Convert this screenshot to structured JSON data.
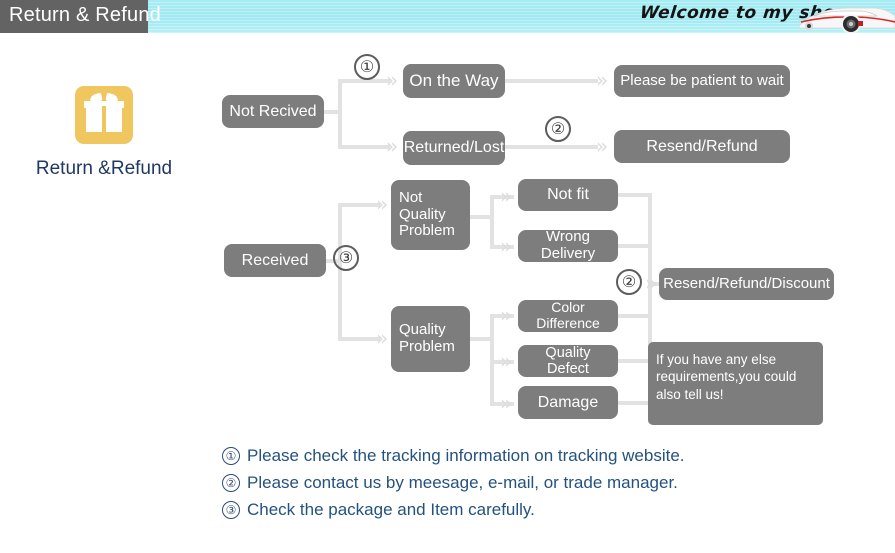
{
  "header": {
    "tab_title": "Return & Refund",
    "welcome_text": "Welcome to my shop",
    "car_icon": "sports-car-image",
    "banner_color": "#9fe9f2",
    "tab_color": "#636363"
  },
  "badge": {
    "icon": "gift-box-icon",
    "icon_color": "#f0c75e",
    "label": "Return &Refund",
    "label_color": "#1f3864"
  },
  "flow": {
    "node_color": "#7d7d7d",
    "line_color": "#e2e2e2",
    "nodes": [
      {
        "id": "not-recived",
        "label": "Not Recived"
      },
      {
        "id": "on-the-way",
        "label": "On the Way"
      },
      {
        "id": "returned-lost",
        "label": "Returned/Lost"
      },
      {
        "id": "please-be-patient",
        "label": "Please be patient to wait"
      },
      {
        "id": "resend-refund",
        "label": "Resend/Refund"
      },
      {
        "id": "received",
        "label": "Received"
      },
      {
        "id": "not-quality-problem",
        "label": "Not Quality Problem"
      },
      {
        "id": "quality-problem",
        "label": "Quality Problem"
      },
      {
        "id": "not-fit",
        "label": "Not fit"
      },
      {
        "id": "wrong-delivery",
        "label": "Wrong Delivery"
      },
      {
        "id": "color-difference",
        "label": "Color Difference"
      },
      {
        "id": "quality-defect",
        "label": "Quality Defect"
      },
      {
        "id": "damage",
        "label": "Damage"
      },
      {
        "id": "resend-refund-discount",
        "label": "Resend/Refund/Discount"
      }
    ],
    "markers": [
      {
        "id": "marker-1-top",
        "label": "①"
      },
      {
        "id": "marker-2-top",
        "label": "②"
      },
      {
        "id": "marker-3-middle",
        "label": "③"
      },
      {
        "id": "marker-2-right",
        "label": "②"
      }
    ],
    "callout": {
      "text": "If you have any else requirements,you could also tell us!"
    }
  },
  "footnotes": [
    {
      "num": "①",
      "text": "Please check the tracking information on tracking website."
    },
    {
      "num": "②",
      "text": "Please contact us by meesage, e-mail, or trade manager."
    },
    {
      "num": "③",
      "text": "Check the package and Item carefully."
    }
  ]
}
